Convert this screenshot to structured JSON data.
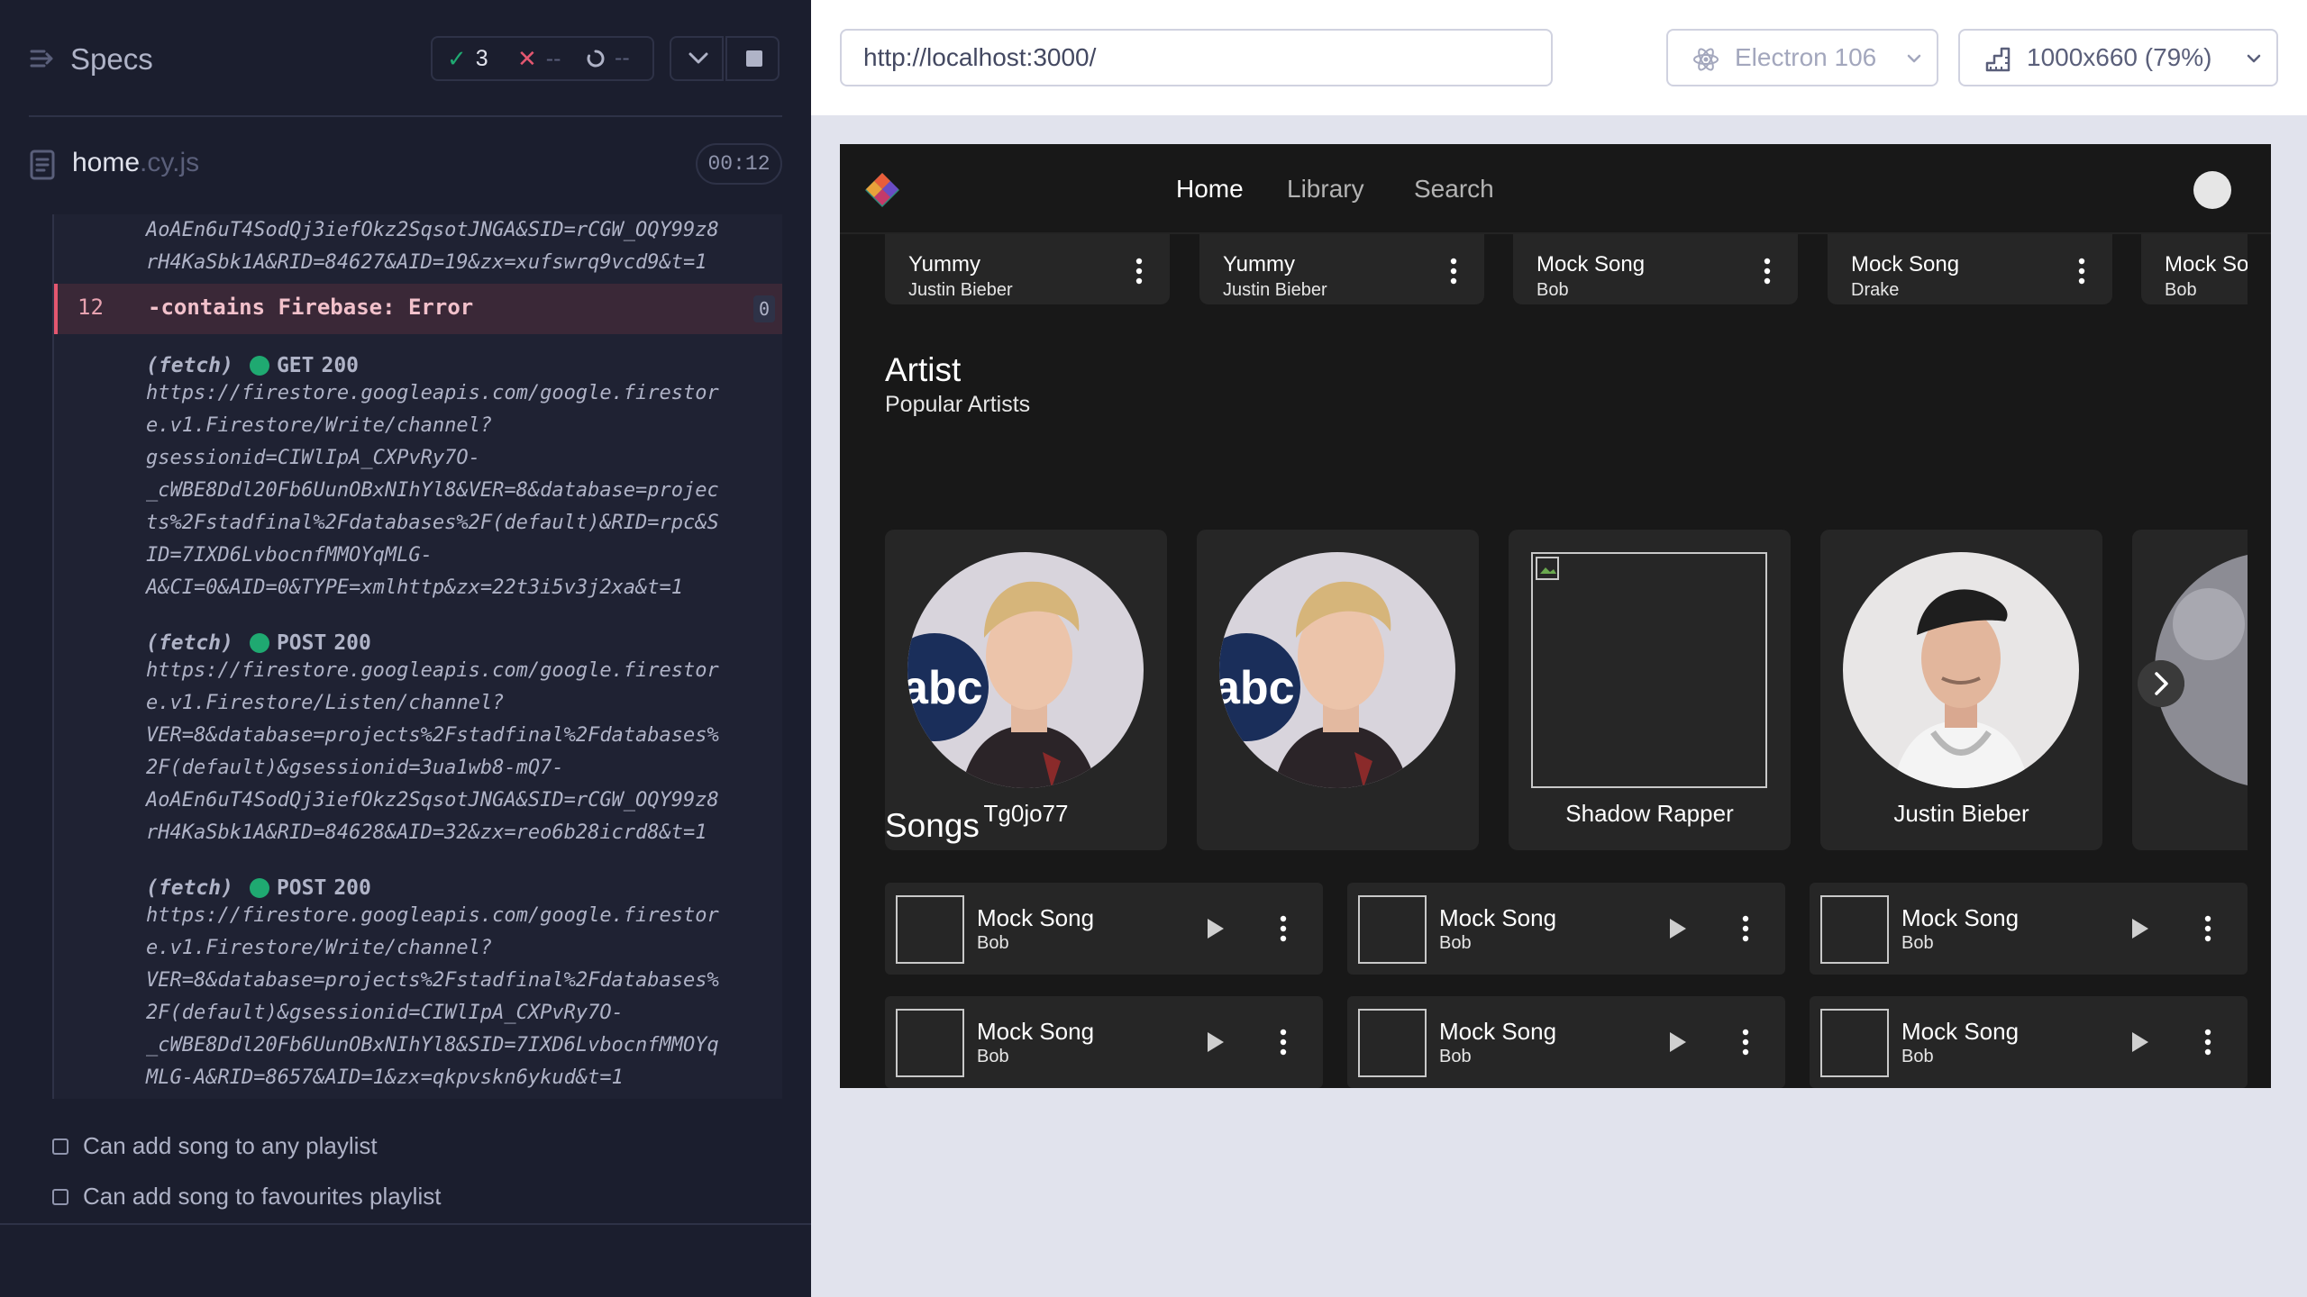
{
  "runner": {
    "title": "Specs",
    "stats": {
      "passed": "3",
      "failed": "--",
      "pending": "--"
    },
    "file": {
      "name": "home",
      "ext": ".cy.js",
      "duration": "00:12"
    },
    "log": {
      "continued_url": [
        "AoAEn6uT4SodQj3iefOkz2SqsotJNGA&SID=rCGW_OQY99z8",
        "rH4KaSbk1A&RID=84627&AID=19&zx=xufswrq9vcd9&t=1"
      ],
      "contains": {
        "num": "12",
        "text": "-contains  Firebase: Error",
        "count": "0"
      },
      "fetches": [
        {
          "label": "(fetch)",
          "method": "GET",
          "status": "200",
          "lines": [
            "https://firestore.googleapis.com/google.firestor",
            "e.v1.Firestore/Write/channel?",
            "gsessionid=CIWlIpA_CXPvRy7O-",
            "_cWBE8Ddl20Fb6UunOBxNIhYl8&VER=8&database=projec",
            "ts%2Fstadfinal%2Fdatabases%2F(default)&RID=rpc&S",
            "ID=7IXD6LvbocnfMMOYqMLG-",
            "A&CI=0&AID=0&TYPE=xmlhttp&zx=22t3i5v3j2xa&t=1"
          ]
        },
        {
          "label": "(fetch)",
          "method": "POST",
          "status": "200",
          "lines": [
            "https://firestore.googleapis.com/google.firestor",
            "e.v1.Firestore/Listen/channel?",
            "VER=8&database=projects%2Fstadfinal%2Fdatabases%",
            "2F(default)&gsessionid=3ua1wb8-mQ7-",
            "AoAEn6uT4SodQj3iefOkz2SqsotJNGA&SID=rCGW_OQY99z8",
            "rH4KaSbk1A&RID=84628&AID=32&zx=reo6b28icrd8&t=1"
          ]
        },
        {
          "label": "(fetch)",
          "method": "POST",
          "status": "200",
          "lines": [
            "https://firestore.googleapis.com/google.firestor",
            "e.v1.Firestore/Write/channel?",
            "VER=8&database=projects%2Fstadfinal%2Fdatabases%",
            "2F(default)&gsessionid=CIWlIpA_CXPvRy7O-",
            "_cWBE8Ddl20Fb6UunOBxNIhYl8&SID=7IXD6LvbocnfMMOYq",
            "MLG-A&RID=8657&AID=1&zx=qkpvskn6ykud&t=1"
          ]
        }
      ]
    },
    "tests": [
      "Can add song to any playlist",
      "Can add song to favourites playlist"
    ]
  },
  "aut": {
    "url": "http://localhost:3000/",
    "browser": "Electron 106",
    "viewport": "1000x660  (79%)",
    "app": {
      "nav": [
        "Home",
        "Library",
        "Search"
      ],
      "top_songs": [
        {
          "title": "Yummy",
          "artist": "Justin Bieber"
        },
        {
          "title": "Yummy",
          "artist": "Justin Bieber"
        },
        {
          "title": "Mock Song",
          "artist": "Bob"
        },
        {
          "title": "Mock Song",
          "artist": "Drake"
        },
        {
          "title": "Mock Song",
          "artist": "Bob"
        }
      ],
      "artist_section": {
        "title": "Artist",
        "subtitle": "Popular Artists"
      },
      "artists": [
        {
          "name": "Tg0jo77",
          "image": "photo"
        },
        {
          "name": "",
          "image": "photo"
        },
        {
          "name": "Shadow Rapper",
          "image": "broken"
        },
        {
          "name": "Justin Bieber",
          "image": "photo-cap"
        },
        {
          "name": "",
          "image": "photo-partial"
        }
      ],
      "songs_section": {
        "title": "Songs"
      },
      "songs": [
        {
          "title": "Mock Song",
          "artist": "Bob"
        },
        {
          "title": "Mock Song",
          "artist": "Bob"
        },
        {
          "title": "Mock Song",
          "artist": "Bob"
        },
        {
          "title": "Mock Song",
          "artist": "Bob"
        },
        {
          "title": "Mock Song",
          "artist": "Bob"
        },
        {
          "title": "Mock Song",
          "artist": "Bob"
        }
      ]
    }
  }
}
